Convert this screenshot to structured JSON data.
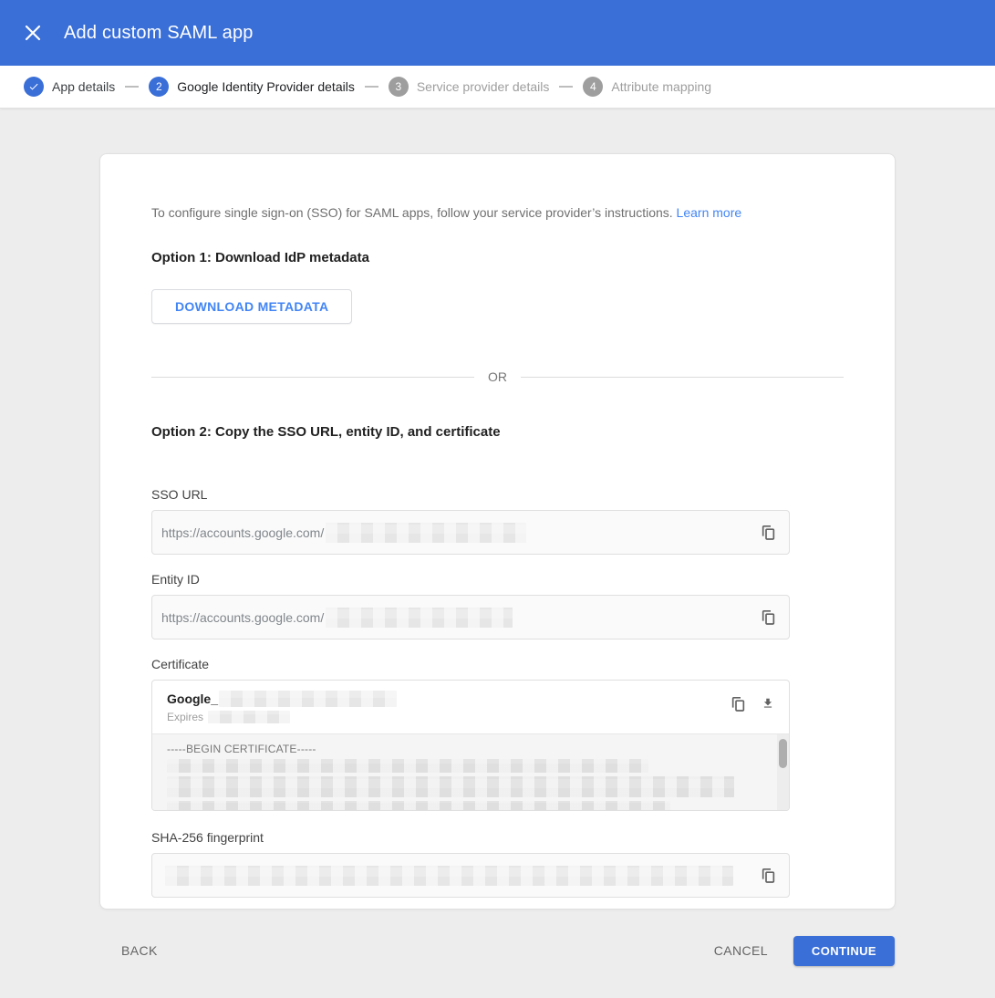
{
  "header": {
    "title": "Add custom SAML app"
  },
  "stepper": {
    "steps": [
      {
        "label": "App details",
        "state": "complete",
        "indicator": "check"
      },
      {
        "label": "Google Identity Provider details",
        "state": "active",
        "indicator": "2"
      },
      {
        "label": "Service provider details",
        "state": "pending",
        "indicator": "3"
      },
      {
        "label": "Attribute mapping",
        "state": "pending",
        "indicator": "4"
      }
    ]
  },
  "main": {
    "intro_text": "To configure single sign-on (SSO) for SAML apps, follow your service provider’s instructions.",
    "learn_more_label": "Learn more",
    "option1_heading": "Option 1: Download IdP metadata",
    "download_button_label": "DOWNLOAD METADATA",
    "divider_label": "OR",
    "option2_heading": "Option 2: Copy the SSO URL, entity ID, and certificate",
    "fields": {
      "sso_url": {
        "label": "SSO URL",
        "value_prefix": "https://accounts.google.com/",
        "value_rest_redacted": true
      },
      "entity_id": {
        "label": "Entity ID",
        "value_prefix": "https://accounts.google.com/",
        "value_rest_redacted": true
      },
      "certificate": {
        "label": "Certificate",
        "name_prefix": "Google_",
        "name_rest_redacted": true,
        "expires_label": "Expires",
        "expires_value_redacted": true,
        "content_first_line": "-----BEGIN CERTIFICATE-----",
        "content_rest_redacted": true
      },
      "sha256": {
        "label": "SHA-256 fingerprint",
        "value_redacted": true
      }
    },
    "icons": {
      "copy": "copy-icon",
      "download": "download-icon"
    }
  },
  "footer": {
    "back_label": "BACK",
    "cancel_label": "CANCEL",
    "continue_label": "CONTINUE"
  },
  "colors": {
    "header_blue": "#3a6fd8",
    "accent_blue": "#4285f4",
    "continue_blue": "#3a6fd8",
    "page_background": "#ededed",
    "pending_gray": "#9e9e9e"
  }
}
